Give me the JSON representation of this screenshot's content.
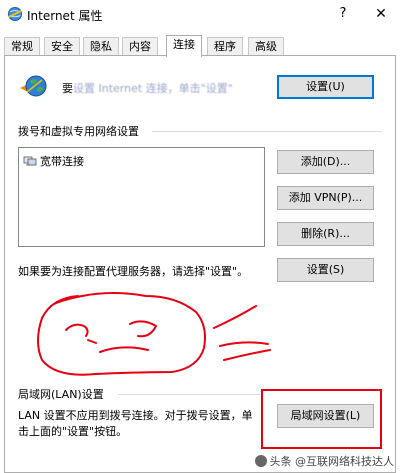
{
  "window": {
    "title": "Internet 属性",
    "help_label": "?",
    "close_label": "✕"
  },
  "tabs": [
    {
      "label": "常规"
    },
    {
      "label": "安全"
    },
    {
      "label": "隐私"
    },
    {
      "label": "内容"
    },
    {
      "label": "连接",
      "active": true
    },
    {
      "label": "程序"
    },
    {
      "label": "高级"
    }
  ],
  "setup": {
    "text_prefix": "要",
    "text_blurred": "设置 Internet 连接，单击\"设置\"",
    "button": "设置(U)"
  },
  "dialup": {
    "group_label": "拨号和虚拟专用网络设置",
    "connections": [
      "宽带连接"
    ],
    "add_button": "添加(D)...",
    "add_vpn_button": "添加 VPN(P)...",
    "remove_button": "删除(R)...",
    "proxy_text": "如果要为连接配置代理服务器，请选择\"设置\"。",
    "settings_button": "设置(S)"
  },
  "lan": {
    "group_label": "局域网(LAN)设置",
    "description": "LAN 设置不应用到拨号连接。对于拨号设置，单击上面的\"设置\"按钮。",
    "button": "局域网设置(L)"
  },
  "watermark": "头条 @互联网络科技达人",
  "colors": {
    "annotation": "#e60012",
    "accent": "#0078d7"
  },
  "icons": [
    "internet-options-icon",
    "globe-icon",
    "network-connection-icon"
  ]
}
